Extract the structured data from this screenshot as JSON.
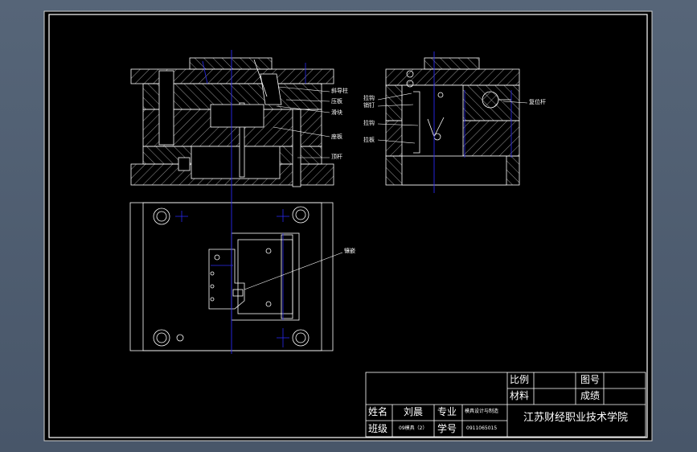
{
  "colors": {
    "background": "#000000",
    "line": "#ffffff",
    "centerline": "#2a2af0",
    "border_gray": "#b4b4b4"
  },
  "callouts": {
    "front": [
      "斜导柱",
      "压板",
      "滑块",
      "座板",
      "顶杆"
    ],
    "side": [
      "拉钩",
      "销钉",
      "拉钩",
      "拉板",
      "复位杆"
    ],
    "plan": "镶嵌"
  },
  "title_block": {
    "ratio_label": "比例",
    "material_label": "材料",
    "drawing_no_label": "图号",
    "score_label": "成绩",
    "name_label": "姓名",
    "name_value": "刘晨",
    "major_label": "专业",
    "major_value": "模具设计与制造",
    "class_label": "班级",
    "class_value": "09模具（2）",
    "student_no_label": "学号",
    "student_no_value": "0911065015",
    "school": "江苏财经职业技术学院"
  }
}
